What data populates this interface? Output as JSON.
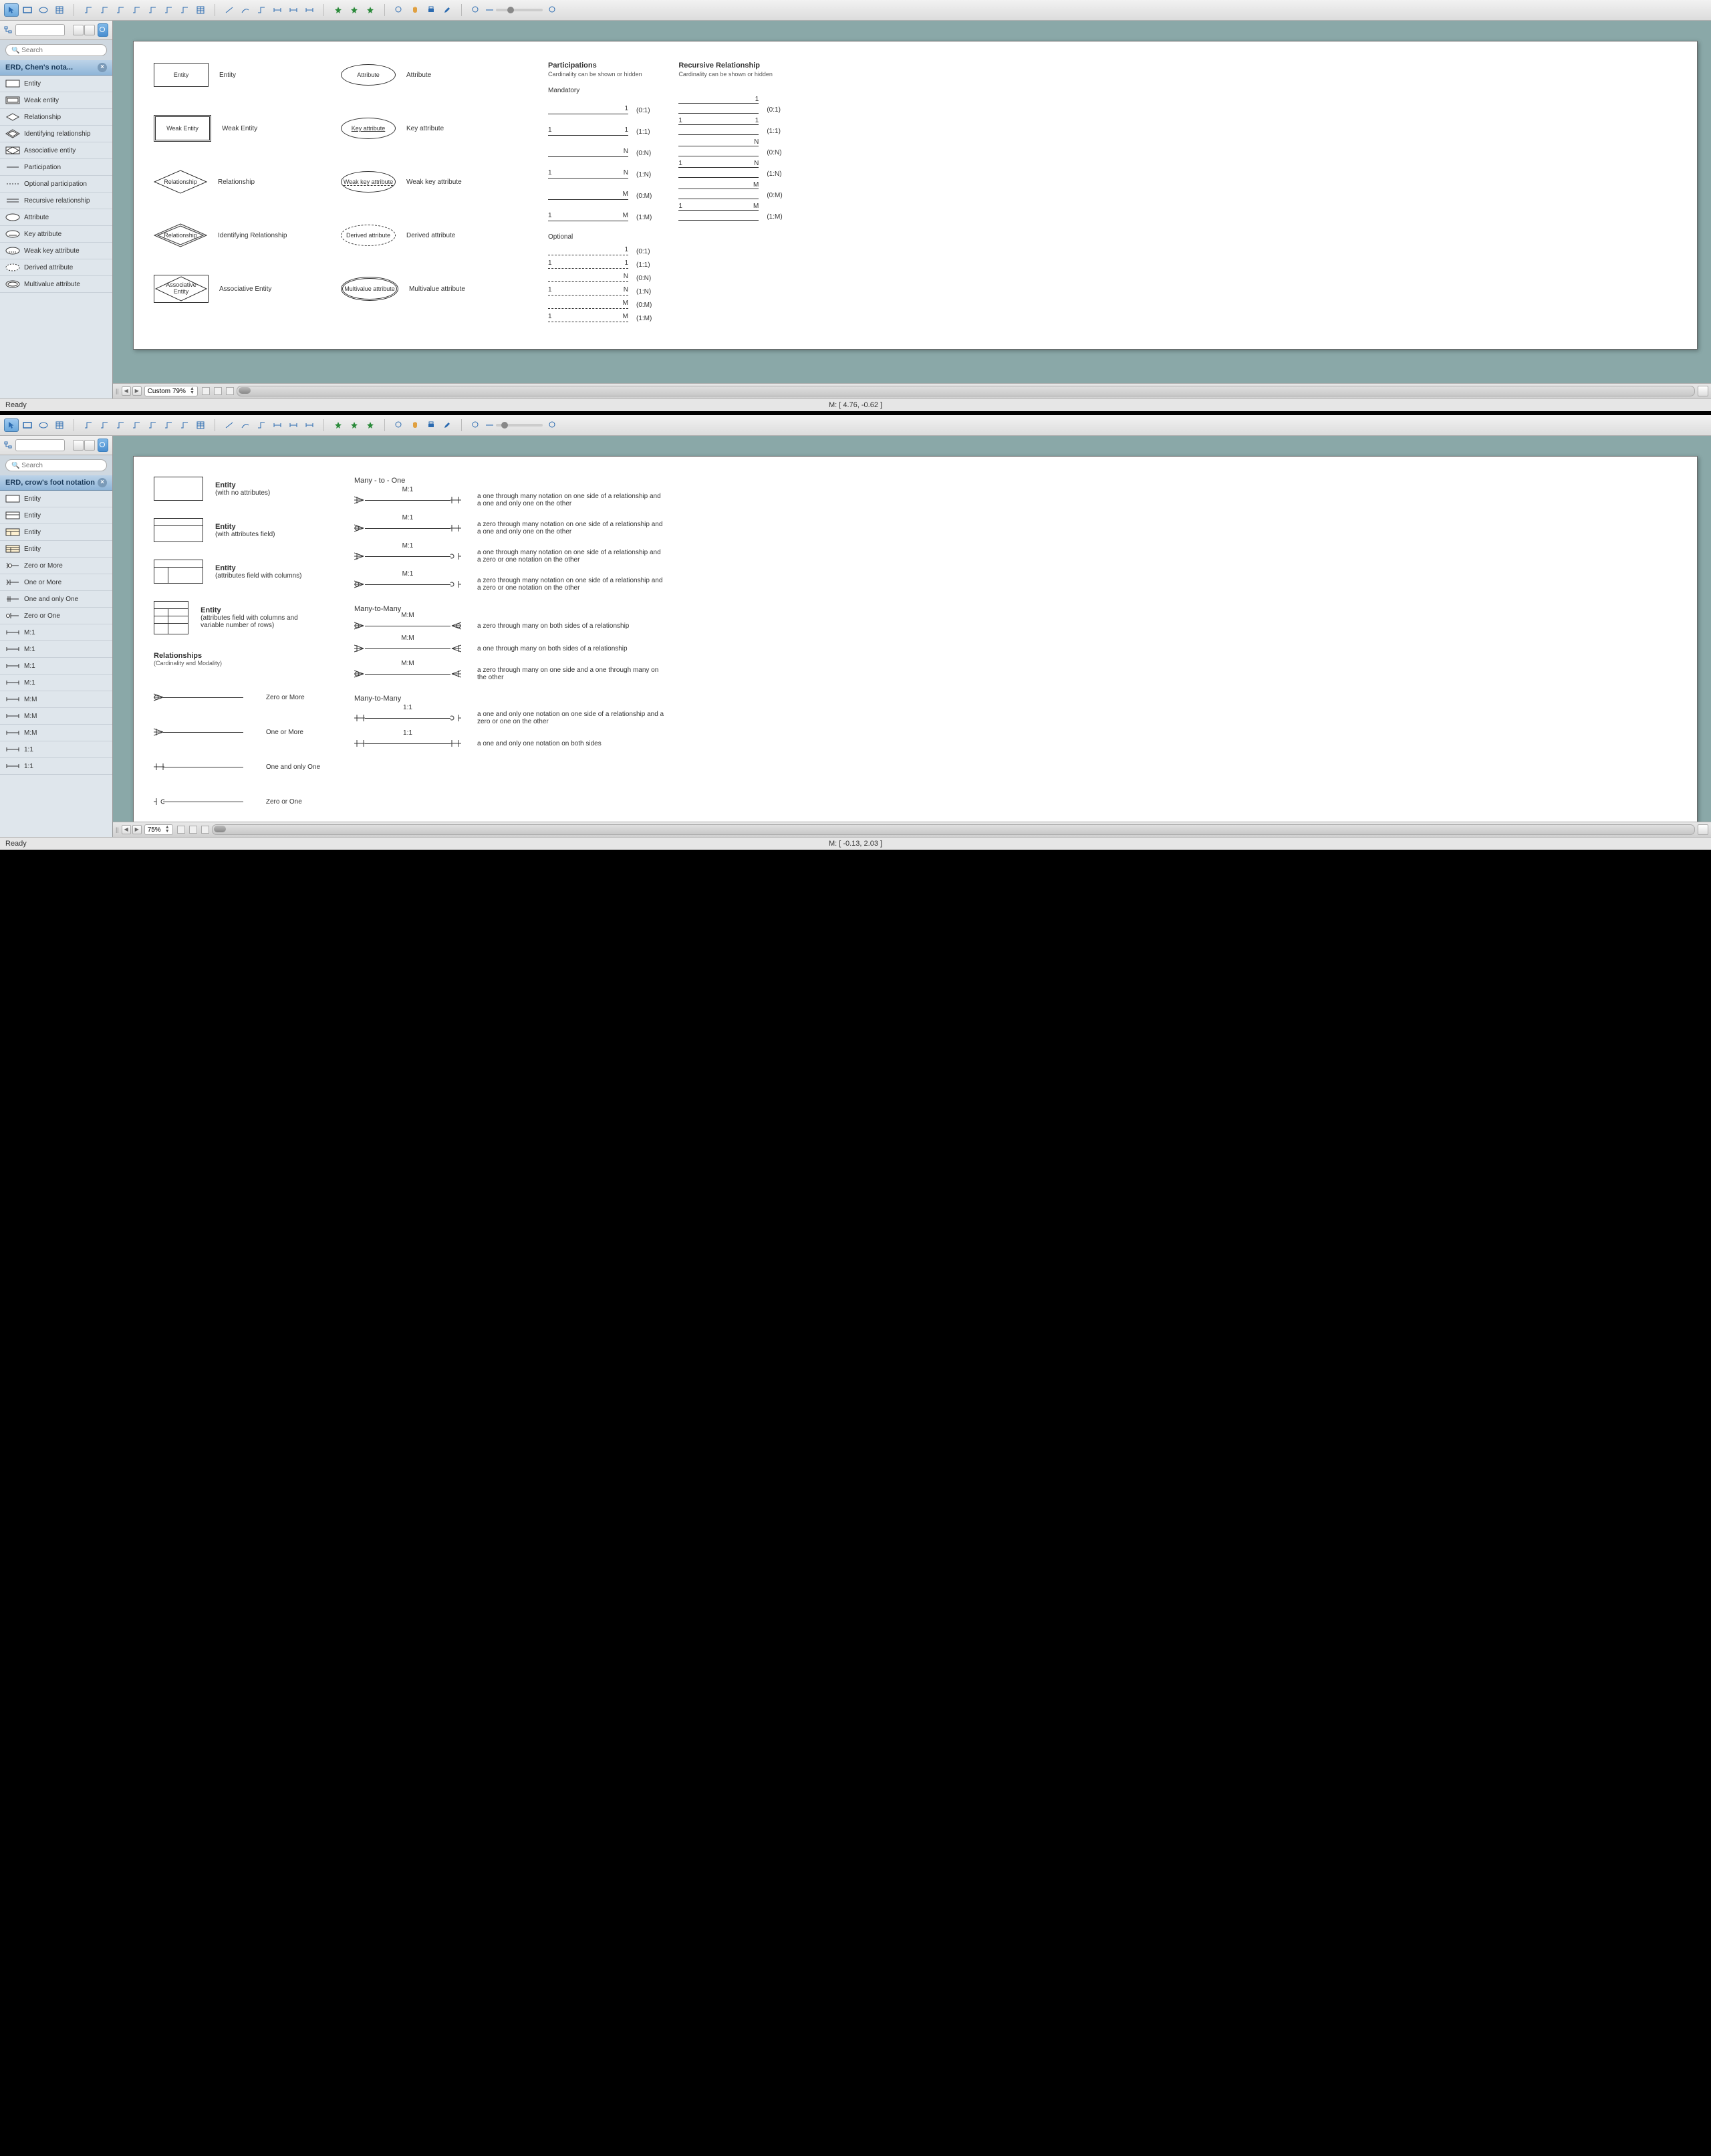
{
  "apps": [
    {
      "key": "chen",
      "panel_title": "ERD, Chen's nota...",
      "search_placeholder": "Search",
      "zoom_label": "Custom 79%",
      "status_left": "Ready",
      "status_coords": "M: [ 4.76, -0.62 ]",
      "slider_pos": "24%",
      "shapes": [
        "Entity",
        "Weak entity",
        "Relationship",
        "Identifying relationship",
        "Associative entity",
        "Participation",
        "Optional participation",
        "Recursive relationship",
        "Attribute",
        "Key attribute",
        "Weak key attribute",
        "Derived attribute",
        "Multivalue attribute"
      ]
    },
    {
      "key": "crow",
      "panel_title": "ERD, crow's foot notation",
      "search_placeholder": "Search",
      "zoom_label": "75%",
      "status_left": "Ready",
      "status_coords": "M: [ -0.13, 2.03 ]",
      "slider_pos": "12%",
      "shapes": [
        "Entity",
        "Entity",
        "Entity",
        "Entity",
        "Zero or More",
        "One or More",
        "One and only One",
        "Zero or One",
        "M:1",
        "M:1",
        "M:1",
        "M:1",
        "M:M",
        "M:M",
        "M:M",
        "1:1",
        "1:1"
      ]
    }
  ],
  "chen_canvas": {
    "left": [
      {
        "shape": "Entity",
        "label": "Entity"
      },
      {
        "shape": "Weak Entity",
        "label": "Weak Entity"
      },
      {
        "shape": "Relationship",
        "label": "Relationship"
      },
      {
        "shape": "Relationship",
        "label": "Identifying Relationship",
        "double": true
      },
      {
        "shape": "Associative\nEntity",
        "label": "Associative Entity",
        "assoc": true
      }
    ],
    "mid": [
      {
        "shape": "Attribute",
        "label": "Attribute"
      },
      {
        "shape": "Key attribute",
        "label": "Key attribute",
        "ul": true
      },
      {
        "shape": "Weak key attribute",
        "label": "Weak key attribute",
        "dul": true
      },
      {
        "shape": "Derived attribute",
        "label": "Derived attribute",
        "dash": true
      },
      {
        "shape": "Multivalue attribute",
        "label": "Multivalue attribute",
        "dbl": true
      }
    ],
    "participations": {
      "title": "Participations",
      "sub": "Cardinality can be shown or hidden",
      "mandatory_label": "Mandatory",
      "mandatory": [
        {
          "l": "",
          "r": "1",
          "c": "(0:1)"
        },
        {
          "l": "1",
          "r": "1",
          "c": "(1:1)"
        },
        {
          "l": "",
          "r": "N",
          "c": "(0:N)"
        },
        {
          "l": "1",
          "r": "N",
          "c": "(1:N)"
        },
        {
          "l": "",
          "r": "M",
          "c": "(0:M)"
        },
        {
          "l": "1",
          "r": "M",
          "c": "(1:M)"
        }
      ],
      "optional_label": "Optional",
      "optional": [
        {
          "l": "",
          "r": "1",
          "c": "(0:1)"
        },
        {
          "l": "1",
          "r": "1",
          "c": "(1:1)"
        },
        {
          "l": "",
          "r": "N",
          "c": "(0:N)"
        },
        {
          "l": "1",
          "r": "N",
          "c": "(1:N)"
        },
        {
          "l": "",
          "r": "M",
          "c": "(0:M)"
        },
        {
          "l": "1",
          "r": "M",
          "c": "(1:M)"
        }
      ]
    },
    "recursive": {
      "title": "Recursive Relationship",
      "sub": "Cardinality can be shown or hidden",
      "rows": [
        {
          "l": "",
          "r": "1",
          "c": "(0:1)"
        },
        {
          "l": "1",
          "r": "1",
          "c": "(1:1)"
        },
        {
          "l": "",
          "r": "N",
          "c": "(0:N)"
        },
        {
          "l": "1",
          "r": "N",
          "c": "(1:N)"
        },
        {
          "l": "",
          "r": "M",
          "c": "(0:M)"
        },
        {
          "l": "1",
          "r": "M",
          "c": "(1:M)"
        }
      ]
    }
  },
  "crow_canvas": {
    "entities": [
      {
        "title": "Entity",
        "sub": "(with no attributes)"
      },
      {
        "title": "Entity",
        "sub": "(with attributes field)"
      },
      {
        "title": "Entity",
        "sub": "(attributes field with columns)"
      },
      {
        "title": "Entity",
        "sub": "(attributes field with columns and variable number of rows)"
      }
    ],
    "rel_header": "Relationships",
    "rel_sub": "(Cardinality and Modality)",
    "rel_basic": [
      {
        "l": "zero-many",
        "label": "Zero or More"
      },
      {
        "l": "one-many",
        "label": "One or More"
      },
      {
        "l": "one-one",
        "label": "One and only One"
      },
      {
        "l": "zero-one",
        "label": "Zero or One"
      }
    ],
    "sections": [
      {
        "title": "Many - to - One",
        "rows": [
          {
            "l": "one-many",
            "r": "one-one",
            "lbl": "M:1",
            "desc": "a one through many notation on one side of a relationship and a one and only one on the other"
          },
          {
            "l": "zero-many",
            "r": "one-one",
            "lbl": "M:1",
            "desc": "a zero through many notation on one side of a relationship and a one and only one on the other"
          },
          {
            "l": "one-many",
            "r": "zero-one",
            "lbl": "M:1",
            "desc": "a one through many notation on one side of a relationship and a zero or one notation on the other"
          },
          {
            "l": "zero-many",
            "r": "zero-one",
            "lbl": "M:1",
            "desc": "a zero through many notation on one side of a relationship and a zero or one notation on the other"
          }
        ]
      },
      {
        "title": "Many-to-Many",
        "rows": [
          {
            "l": "zero-many",
            "r": "zero-many",
            "lbl": "M:M",
            "desc": "a zero through many on both sides of a relationship"
          },
          {
            "l": "one-many",
            "r": "one-many",
            "lbl": "M:M",
            "desc": "a one through many on both sides of a relationship"
          },
          {
            "l": "zero-many",
            "r": "one-many",
            "lbl": "M:M",
            "desc": "a zero through many on one side and a one through many on the other"
          }
        ]
      },
      {
        "title": "Many-to-Many",
        "rows": [
          {
            "l": "one-one",
            "r": "zero-one",
            "lbl": "1:1",
            "desc": "a one and only one notation on one side of a relationship and a zero or one on the other"
          },
          {
            "l": "one-one",
            "r": "one-one",
            "lbl": "1:1",
            "desc": "a one and only one notation on both sides"
          }
        ]
      }
    ]
  }
}
